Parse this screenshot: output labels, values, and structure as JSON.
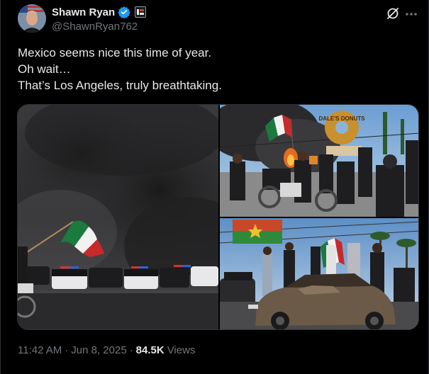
{
  "author": {
    "display_name": "Shawn Ryan",
    "handle": "@ShawnRyan762"
  },
  "icons": {
    "verified": "verified-badge-icon",
    "affiliation": "affiliation-badge-icon",
    "grok": "grok-icon",
    "more": "more-options-icon"
  },
  "tweet": {
    "lines": [
      "Mexico seems nice this time of year.",
      "Oh wait…",
      "That’s Los Angeles, truly breathtaking."
    ]
  },
  "photos": {
    "sign_text": "DALE'S DONUTS"
  },
  "meta": {
    "time": "11:42 AM",
    "separator": "·",
    "date": "Jun 8, 2025",
    "views_count": "84.5K",
    "views_label": "Views"
  },
  "colors": {
    "accent_blue": "#1d9bf0",
    "text_primary": "#e7e9ea",
    "text_secondary": "#71767b",
    "border": "#2f3336"
  }
}
